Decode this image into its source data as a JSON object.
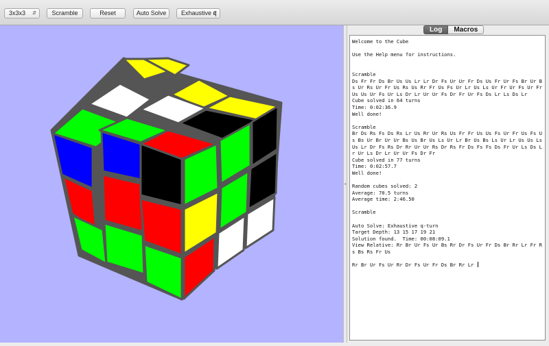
{
  "toolbar": {
    "size_select": "3x3x3",
    "scramble_label": "Scramble",
    "reset_label": "Reset",
    "auto_solve_label": "Auto Solve",
    "solver_select": "Exhaustive q"
  },
  "tabs": [
    {
      "label": "Log",
      "active": true
    },
    {
      "label": "Macros",
      "active": false
    }
  ],
  "log_lines": [
    "Welcome to the Cube",
    "",
    "Use the Help menu for instructions.",
    "",
    "",
    "Scramble",
    "Ds Fr Fr Ds Br Us Us Lr Lr Dr Fs Ur Ur Fr Ds Us Fr Ur Fs Br Ur Bs Ur Rs Ur Fr Us Rs Us Rr Fr Us Fs Ur Lr Us Ls Ur Fr Ur Fs Ur Fr Us Us Ur Fs Ur Ls Dr Lr Ur Ur Fs Dr Fr Ur Fs Ds Lr Ls Ds Lr",
    "Cube solved in 64 turns",
    "Time: 0:02:36.9",
    "Well done!",
    "",
    "Scramble",
    "Br Ds Rs Fs Ds Rs Lr Us Rr Ur Rs Us Fr Fr Us Us Fs Ur Fr Us Fs Us Bs Ur Br Ur Ur Bs Us Br Us Ls Ur Lr Br Us Bs Ls Ur Lr Us Us Ls Us Lr Dr Fs Rs Dr Rr Ur Ur Rs Dr Rs Fr Ds Fs Fs Ds Fr Ur Ls Ds Lr Ur Ls Dr Lr Ur Ur Fs Dr Fr",
    "Cube solved in 77 turns",
    "Time: 0:02:57.7",
    "Well done!",
    "",
    "Random cubes solved: 2",
    "Average: 70.5 turns",
    "Average time: 2:46.50",
    "",
    "Scramble",
    "",
    "Auto Solve: Exhaustive q-turn",
    "Target Depth: 13 15 17 19 21",
    "Solution found.  Time: 00:08:09.1",
    "View Relative: Rr Br Ur Fs Ur Bs Rr Dr Fs Ur Fr Ds Br Rr Lr Fr Rs Bs Rs Fr Us",
    "",
    "Rr Br Ur Fs Ur Rr Dr Fs Ur Fr Ds Br Rr Lr "
  ],
  "cube_colors": {
    "yellow": "#ffff00",
    "white": "#ffffff",
    "green": "#00ff00",
    "blue": "#0000ff",
    "red": "#ff0000",
    "black": "#000000",
    "body": "#555555",
    "background": "#b3b3ff"
  }
}
